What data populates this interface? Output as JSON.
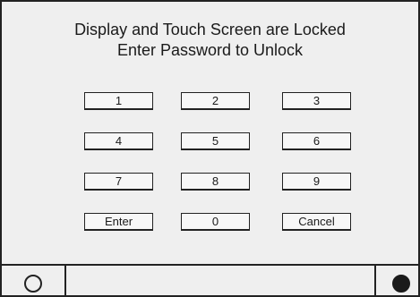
{
  "header": {
    "line1": "Display and Touch Screen are Locked",
    "line2": "Enter Password to Unlock"
  },
  "keypad": {
    "k1": "1",
    "k2": "2",
    "k3": "3",
    "k4": "4",
    "k5": "5",
    "k6": "6",
    "k7": "7",
    "k8": "8",
    "k9": "9",
    "enter": "Enter",
    "k0": "0",
    "cancel": "Cancel"
  },
  "footer": {
    "left_icon": "hollow-circle-icon",
    "right_icon": "filled-circle-icon"
  },
  "colors": {
    "screen_background": "#efefef",
    "border": "#222222"
  }
}
